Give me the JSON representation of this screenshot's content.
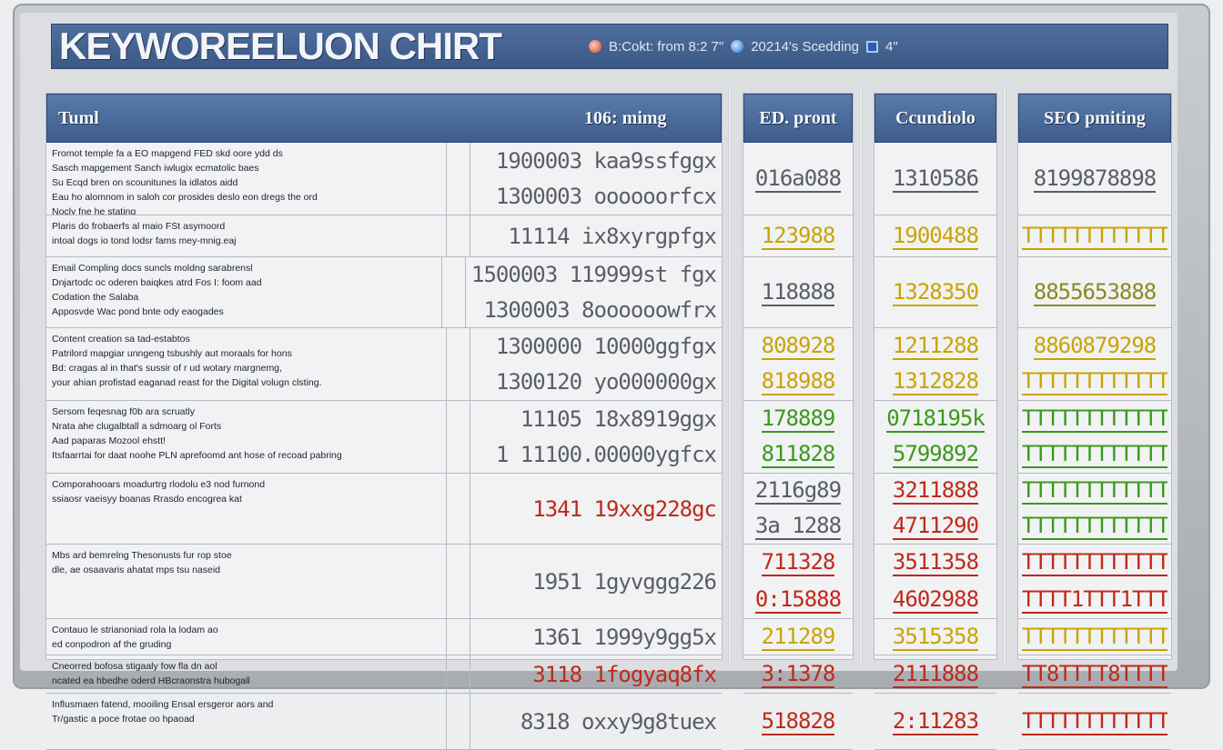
{
  "title": "KEYWOREELUON CHIRT",
  "toolbar": {
    "status_text": "B:Cokt: from 8:2  7\"",
    "search_text": "20214's  Scedding",
    "extra": "4\""
  },
  "colors": {
    "gray": "#5a5e64",
    "yellow": "#c9a400",
    "green": "#3a9a1a",
    "red": "#c0291a",
    "olive": "#8a8a20"
  },
  "main_panel": {
    "header_left": "Tuml",
    "header_right": "106:  mimg",
    "rows": [
      {
        "lines": [
          "Fromot temple fa a EO mapgend FED skd oore ydd ds",
          "Sasch mapgement Sanch iwlugix ecmatolic baes",
          "Su Ecqd bren on scounitunes la idlatos aidd",
          "Eau ho alomnom in saloh cor prosides deslo eon dregs the ord",
          "Nocly fne he stating"
        ],
        "values": [
          "1900003 kaa9ssfggx",
          "1300003 oooooorfcx"
        ],
        "color": "gray"
      },
      {
        "lines": [
          "Plaris do frobaerfs al maio FSt asymoord",
          "intoal dogs io tond lodsr fams mey-mnig.eaj"
        ],
        "values": [
          "11114 ix8xyrgpfgx"
        ],
        "color": "gray"
      },
      {
        "lines": [
          "Email Compling docs suncls moldng sarabrensl",
          "Dnjartodc oc oderen baiqkes atrd Fos I: foom aad",
          "Codation the Salaba",
          "Apposvde Wac pond bnte ody eaogades"
        ],
        "values": [
          "1500003 119999st fgx",
          "1300003 8oooooowfrx"
        ],
        "color": "gray"
      },
      {
        "lines": [
          "Content creation sa tad-estabtos",
          "Patrilord mapgiar unngeng tsbushly aut moraals for hons",
          "Bd: cragas al in that's sussir of r ud wotary margnemg,",
          "your ahian profistad eaganad reast for the Digital volugn clsting."
        ],
        "values": [
          "1300000 10000ggfgx",
          "1300120 yo000000gx"
        ],
        "color": "gray"
      },
      {
        "lines": [
          "Sersom feqesnag f0b ara scruatly",
          "Nrata ahe clugalbtall a sdmoarg ol Forts",
          "Aad paparas Mozool ehstt!",
          "Itsfaarrtai for daat noohe PLN aprefoomd ant hose of recoad pabring"
        ],
        "values": [
          "11105 18x8919ggx",
          "1 11100.00000ygfcx"
        ],
        "color": "gray"
      },
      {
        "lines": [
          "Comporahooars moadurtrg rlodolu e3 nod furnond",
          "ssiaosr vaeisyy boanas Rrasdo encogrea kat"
        ],
        "values": [
          "1341 19xxg228gc"
        ],
        "color": "red"
      },
      {
        "lines": [
          "Mbs ard bemrelng Thesonusts fur rop stoe",
          "dle, ae osaavaris ahatat mps tsu naseid"
        ],
        "values": [
          "1951 1gyvggg226"
        ],
        "color": "gray"
      },
      {
        "lines": [
          "Contauo le strianoniad rola la lodam ao",
          "ed conpodron af the gruding"
        ],
        "values": [
          "1361 1999y9gg5x"
        ],
        "color": "gray"
      },
      {
        "lines": [
          "Cneorred bofosa stigaaly fow fla dn aol",
          "ncated ea hbedhe oderd HBcraonstra hubogall"
        ],
        "values": [
          "3118 1fogyaq8fx"
        ],
        "color": "red"
      },
      {
        "lines": [
          "Influsmaen fatend, mooiling Ensal ersgeror aors and",
          "Tr/gastic a poce frotae oo hpaoad"
        ],
        "values": [
          "8318 oxxy9g8tuex"
        ],
        "color": "gray"
      }
    ]
  },
  "ed_panel": {
    "header": "ED. pront",
    "cells": [
      {
        "values": [
          "016a088"
        ],
        "color": "gray"
      },
      {
        "values": [
          "123988"
        ],
        "color": "yellow"
      },
      {
        "values": [
          "118888"
        ],
        "color": "gray"
      },
      {
        "values": [
          "808928",
          "818988"
        ],
        "color": "yellow"
      },
      {
        "values": [
          "178889",
          "811828"
        ],
        "color": "green"
      },
      {
        "values": [
          "2116g89",
          "3a 1288"
        ],
        "color": "gray"
      },
      {
        "values": [
          "711328",
          "0:15888"
        ],
        "color": "red"
      },
      {
        "values": [
          "211289"
        ],
        "color": "yellow"
      },
      {
        "values": [
          "3:1378"
        ],
        "color": "red"
      },
      {
        "values": [
          "518828"
        ],
        "color": "red"
      }
    ]
  },
  "cand_panel": {
    "header": "Ccundiolo",
    "cells": [
      {
        "values": [
          "1310586"
        ],
        "color": "gray"
      },
      {
        "values": [
          "1900488"
        ],
        "color": "yellow"
      },
      {
        "values": [
          "1328350"
        ],
        "color": "yellow"
      },
      {
        "values": [
          "1211288",
          "1312828"
        ],
        "color": "yellow"
      },
      {
        "values": [
          "0718195k",
          "5799892"
        ],
        "color": "green"
      },
      {
        "values": [
          "3211888",
          "4711290"
        ],
        "color": "red"
      },
      {
        "values": [
          "3511358",
          "4602988"
        ],
        "color": "red"
      },
      {
        "values": [
          "3515358"
        ],
        "color": "yellow"
      },
      {
        "values": [
          "2111888"
        ],
        "color": "red"
      },
      {
        "values": [
          "2:11283"
        ],
        "color": "red"
      }
    ]
  },
  "seo_panel": {
    "header": "SEO pmiting",
    "cells": [
      {
        "values": [
          "8199878898"
        ],
        "color": "gray"
      },
      {
        "values": [
          "TTTTTTTTTTTT"
        ],
        "color": "yellow"
      },
      {
        "values": [
          "8855653888"
        ],
        "color": "olive"
      },
      {
        "values": [
          "8860879298",
          "TTTTTTTTTTTT"
        ],
        "color": "yellow"
      },
      {
        "values": [
          "TTTTTTTTTTTT",
          "TTTTTTTTTTTT"
        ],
        "color": "green"
      },
      {
        "values": [
          "TTTTTTTTTTTT",
          "TTTTTTTTTTTT"
        ],
        "color": "green"
      },
      {
        "values": [
          "TTTTTTTTTTTT",
          "TTTT1TTT1TTT"
        ],
        "color": "red"
      },
      {
        "values": [
          "TTTTTTTTTTTT"
        ],
        "color": "yellow"
      },
      {
        "values": [
          "TT8TTTT8TTTT"
        ],
        "color": "red"
      },
      {
        "values": [
          "TTTTTTTTTTTT"
        ],
        "color": "red"
      }
    ]
  }
}
